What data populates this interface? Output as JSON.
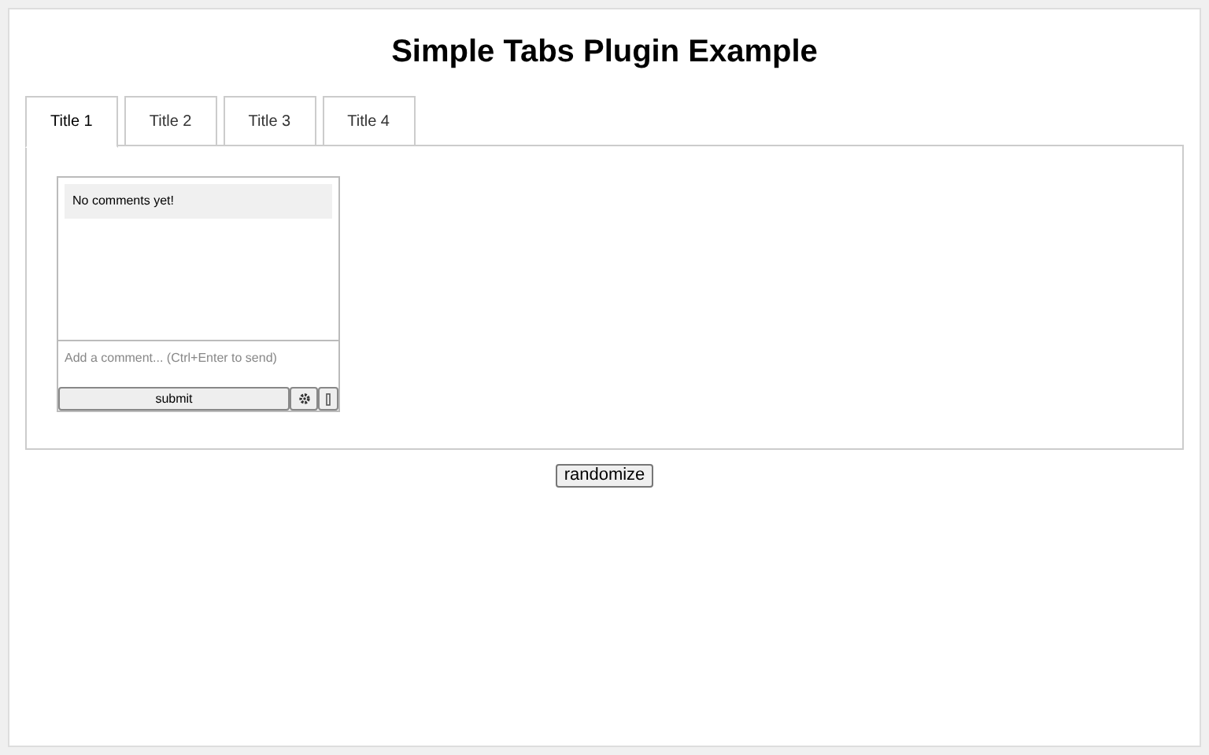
{
  "title": "Simple Tabs Plugin Example",
  "tabs": [
    {
      "label": "Title 1",
      "selected": true
    },
    {
      "label": "Title 2",
      "selected": false
    },
    {
      "label": "Title 3",
      "selected": false
    },
    {
      "label": "Title 4",
      "selected": false
    }
  ],
  "comments": {
    "empty_message": "No comments yet!",
    "input": {
      "placeholder": "Add a comment... (Ctrl+Enter to send)"
    },
    "submit": "submit"
  },
  "randomize": "randomize"
}
